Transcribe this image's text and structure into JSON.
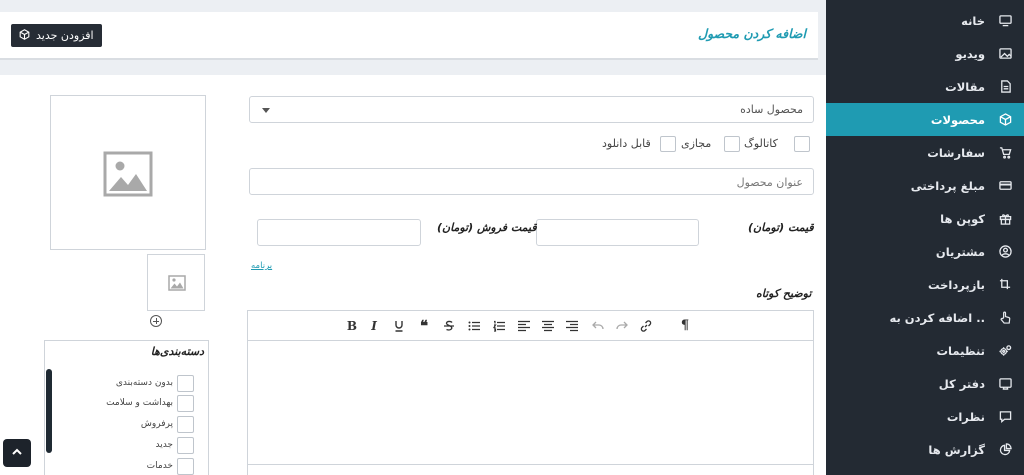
{
  "sidebar": {
    "items": [
      {
        "label": "خانه",
        "icon": "monitor-icon"
      },
      {
        "label": "ویدیو",
        "icon": "image-icon"
      },
      {
        "label": "مقالات",
        "icon": "document-icon"
      },
      {
        "label": "محصولات",
        "icon": "box-icon",
        "active": true
      },
      {
        "label": "سفارشات",
        "icon": "cart-icon"
      },
      {
        "label": "مبلغ پرداختی",
        "icon": "credit-card-icon"
      },
      {
        "label": "کوپن ها",
        "icon": "gift-icon"
      },
      {
        "label": "مشتریان",
        "icon": "user-circle-icon"
      },
      {
        "label": "بازپرداخت",
        "icon": "refund-icon"
      },
      {
        "label": "اضافه کردن به ..",
        "icon": "pointer-hand-icon"
      },
      {
        "label": "تنظیمات",
        "icon": "gears-icon"
      },
      {
        "label": "دفتر کل",
        "icon": "ledger-icon"
      },
      {
        "label": "نظرات",
        "icon": "comment-icon"
      },
      {
        "label": "گزارش ها",
        "icon": "chart-pie-icon"
      }
    ]
  },
  "header": {
    "title": "اضافه کردن محصول",
    "add_new_label": "افزودن جدید"
  },
  "form": {
    "product_type": "محصول ساده",
    "checkboxes": [
      {
        "label": "کاتالوگ"
      },
      {
        "label": "مجازی"
      },
      {
        "label": "قابل دانلود"
      }
    ],
    "title_placeholder": "عنوان محصول",
    "price_label": "قیمت (تومان)",
    "sale_price_label": "قیمت فروش (تومان)",
    "schedule_link": "برنامه",
    "short_desc_label": "توضیح کوتاه"
  },
  "categories": {
    "title": "دسته‌بندی‌ها",
    "items": [
      "بدون دسته‌بندی",
      "بهداشت و سلامت",
      "پرفروش",
      "جدید",
      "خدمات"
    ]
  },
  "colors": {
    "accent": "#1f9bb2",
    "sidebar_bg": "#232a33",
    "button_dark": "#262c35"
  }
}
